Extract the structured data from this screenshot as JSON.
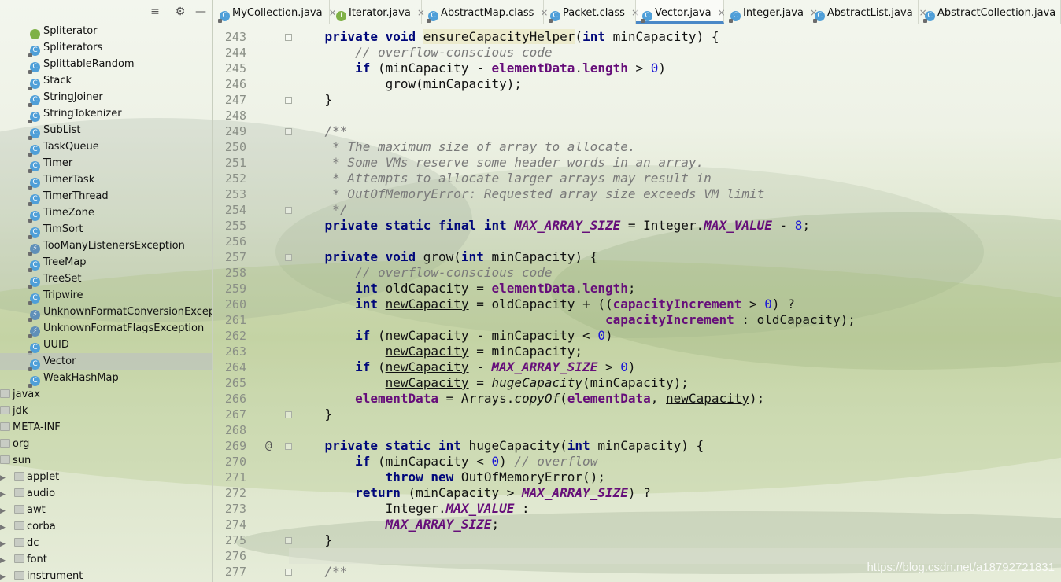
{
  "sidebar": {
    "tree": [
      {
        "label": "Spliterator",
        "kind": "interface",
        "indent": 38
      },
      {
        "label": "Spliterators",
        "kind": "class",
        "indent": 38
      },
      {
        "label": "SplittableRandom",
        "kind": "class",
        "indent": 38
      },
      {
        "label": "Stack",
        "kind": "class",
        "indent": 38
      },
      {
        "label": "StringJoiner",
        "kind": "class",
        "indent": 38
      },
      {
        "label": "StringTokenizer",
        "kind": "class",
        "indent": 38
      },
      {
        "label": "SubList",
        "kind": "class",
        "indent": 38
      },
      {
        "label": "TaskQueue",
        "kind": "class",
        "indent": 38
      },
      {
        "label": "Timer",
        "kind": "class",
        "indent": 38
      },
      {
        "label": "TimerTask",
        "kind": "class",
        "indent": 38
      },
      {
        "label": "TimerThread",
        "kind": "class",
        "indent": 38
      },
      {
        "label": "TimeZone",
        "kind": "class",
        "indent": 38
      },
      {
        "label": "TimSort",
        "kind": "class",
        "indent": 38
      },
      {
        "label": "TooManyListenersException",
        "kind": "exception",
        "indent": 38
      },
      {
        "label": "TreeMap",
        "kind": "class",
        "indent": 38
      },
      {
        "label": "TreeSet",
        "kind": "class",
        "indent": 38
      },
      {
        "label": "Tripwire",
        "kind": "class",
        "indent": 38
      },
      {
        "label": "UnknownFormatConversionException",
        "kind": "exception",
        "indent": 38
      },
      {
        "label": "UnknownFormatFlagsException",
        "kind": "exception",
        "indent": 38
      },
      {
        "label": "UUID",
        "kind": "class",
        "indent": 38
      },
      {
        "label": "Vector",
        "kind": "class",
        "indent": 38,
        "selected": true
      },
      {
        "label": "WeakHashMap",
        "kind": "class",
        "indent": 38
      },
      {
        "label": "javax",
        "kind": "package",
        "indent": 0
      },
      {
        "label": "jdk",
        "kind": "package",
        "indent": 0
      },
      {
        "label": "META-INF",
        "kind": "package",
        "indent": 0
      },
      {
        "label": "org",
        "kind": "package",
        "indent": 0
      },
      {
        "label": "sun",
        "kind": "package",
        "indent": 0
      },
      {
        "label": "applet",
        "kind": "package",
        "indent": 18,
        "arrow": true
      },
      {
        "label": "audio",
        "kind": "package",
        "indent": 18,
        "arrow": true
      },
      {
        "label": "awt",
        "kind": "package",
        "indent": 18,
        "arrow": true
      },
      {
        "label": "corba",
        "kind": "package",
        "indent": 18,
        "arrow": true
      },
      {
        "label": "dc",
        "kind": "package",
        "indent": 18,
        "arrow": true
      },
      {
        "label": "font",
        "kind": "package",
        "indent": 18,
        "arrow": true
      },
      {
        "label": "instrument",
        "kind": "package",
        "indent": 18,
        "arrow": true
      }
    ],
    "toolbar_icons": [
      "collapse-icon",
      "gear-icon",
      "hide-icon"
    ]
  },
  "tabs": [
    {
      "label": "MyCollection.java",
      "kind": "class"
    },
    {
      "label": "Iterator.java",
      "kind": "interface"
    },
    {
      "label": "AbstractMap.class",
      "kind": "class"
    },
    {
      "label": "Packet.class",
      "kind": "class"
    },
    {
      "label": "Vector.java",
      "kind": "class",
      "active": true
    },
    {
      "label": "Integer.java",
      "kind": "class"
    },
    {
      "label": "AbstractList.java",
      "kind": "class"
    },
    {
      "label": "AbstractCollection.java",
      "kind": "class"
    }
  ],
  "editor": {
    "lines": [
      {
        "n": "243",
        "html": "    <span class='kw'>private void</span> <span class='hl-method'>ensureCapacityHelper</span>(<span class='kw'>int</span> minCapacity) {",
        "fold": true
      },
      {
        "n": "244",
        "html": "        <span class='cm'>// overflow-conscious code</span>"
      },
      {
        "n": "245",
        "html": "        <span class='kw'>if</span> (minCapacity - <span class='fld'>elementData</span>.<span class='fld'>length</span> &gt; <span class='num'>0</span>)"
      },
      {
        "n": "246",
        "html": "            grow(minCapacity);"
      },
      {
        "n": "247",
        "html": "    }",
        "fold": true
      },
      {
        "n": "248",
        "html": ""
      },
      {
        "n": "249",
        "html": "    <span class='cm'>/**</span>",
        "fold": true
      },
      {
        "n": "250",
        "html": "<span class='cm'>     * The maximum size of array to allocate.</span>"
      },
      {
        "n": "251",
        "html": "<span class='cm'>     * Some VMs reserve some header words in an array.</span>"
      },
      {
        "n": "252",
        "html": "<span class='cm'>     * Attempts to allocate larger arrays may result in</span>"
      },
      {
        "n": "253",
        "html": "<span class='cm'>     * OutOfMemoryError: Requested array size exceeds VM limit</span>"
      },
      {
        "n": "254",
        "html": "<span class='cm'>     */</span>",
        "fold": true
      },
      {
        "n": "255",
        "html": "    <span class='kw'>private static final int</span> <span class='sf'>MAX_ARRAY_SIZE</span> = Integer.<span class='sf'>MAX_VALUE</span> - <span class='num'>8</span>;"
      },
      {
        "n": "256",
        "html": ""
      },
      {
        "n": "257",
        "html": "    <span class='kw'>private void</span> grow(<span class='kw'>int</span> minCapacity) {",
        "fold": true
      },
      {
        "n": "258",
        "html": "        <span class='cm'>// overflow-conscious code</span>"
      },
      {
        "n": "259",
        "html": "        <span class='kw'>int</span> oldCapacity = <span class='fld'>elementData</span>.<span class='fld'>length</span>;"
      },
      {
        "n": "260",
        "html": "        <span class='kw'>int</span> <span class='ul'>newCapacity</span> = oldCapacity + ((<span class='fld'>capacityIncrement</span> &gt; <span class='num'>0</span>) ?"
      },
      {
        "n": "261",
        "html": "                                         <span class='fld'>capacityIncrement</span> : oldCapacity);"
      },
      {
        "n": "262",
        "html": "        <span class='kw'>if</span> (<span class='ul'>newCapacity</span> - minCapacity &lt; <span class='num'>0</span>)"
      },
      {
        "n": "263",
        "html": "            <span class='ul'>newCapacity</span> = minCapacity;"
      },
      {
        "n": "264",
        "html": "        <span class='kw'>if</span> (<span class='ul'>newCapacity</span> - <span class='sf'>MAX_ARRAY_SIZE</span> &gt; <span class='num'>0</span>)"
      },
      {
        "n": "265",
        "html": "            <span class='ul'>newCapacity</span> = <span class='st'>hugeCapacity</span>(minCapacity);"
      },
      {
        "n": "266",
        "html": "        <span class='fld'>elementData</span> = Arrays.<span class='st'>copyOf</span>(<span class='fld'>elementData</span>, <span class='ul'>newCapacity</span>);"
      },
      {
        "n": "267",
        "html": "    }",
        "fold": true
      },
      {
        "n": "268",
        "html": ""
      },
      {
        "n": "269",
        "html": "    <span class='kw'>private static int</span> hugeCapacity(<span class='kw'>int</span> minCapacity) {",
        "at": "@",
        "fold": true
      },
      {
        "n": "270",
        "html": "        <span class='kw'>if</span> (minCapacity &lt; <span class='num'>0</span>) <span class='cm'>// overflow</span>"
      },
      {
        "n": "271",
        "html": "            <span class='kw'>throw new</span> OutOfMemoryError();"
      },
      {
        "n": "272",
        "html": "        <span class='kw'>return</span> (minCapacity &gt; <span class='sf'>MAX_ARRAY_SIZE</span>) ?"
      },
      {
        "n": "273",
        "html": "            Integer.<span class='sf'>MAX_VALUE</span> :"
      },
      {
        "n": "274",
        "html": "            <span class='sf'>MAX_ARRAY_SIZE</span>;"
      },
      {
        "n": "275",
        "html": "    }",
        "fold": true
      },
      {
        "n": "276",
        "html": "",
        "current": true
      },
      {
        "n": "277",
        "html": "    <span class='cm'>/**</span>",
        "fold": true
      }
    ]
  },
  "watermark": "https://blog.csdn.net/a18792721831"
}
